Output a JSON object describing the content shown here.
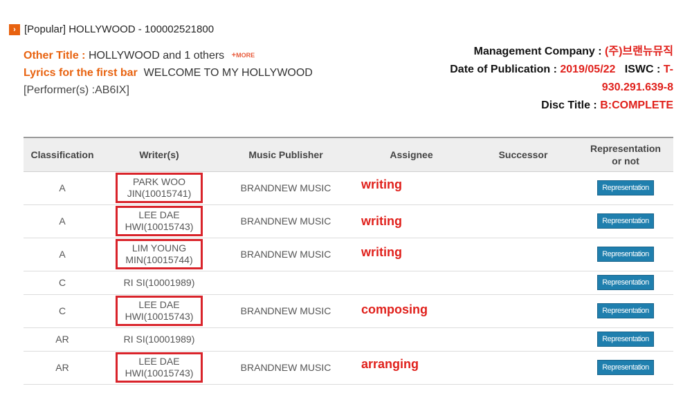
{
  "header": {
    "title": "[Popular] HOLLYWOOD - 100002521800",
    "icon": "chevron-right-icon"
  },
  "info_left": {
    "other_title_label": "Other Title :",
    "other_title_value": "HOLLYWOOD and 1 others",
    "more_label": "MORE",
    "lyrics_label": "Lyrics for the first bar",
    "lyrics_value": "WELCOME TO MY HOLLYWOOD",
    "performer": "[Performer(s) :AB6IX]"
  },
  "info_right": {
    "management_label": "Management Company :",
    "management_value": "(주)브랜뉴뮤직",
    "date_label": "Date of Publication :",
    "date_value": "2019/05/22",
    "iswc_label": "ISWC :",
    "iswc_value_part1": "T-",
    "iswc_value_part2": "930.291.639-8",
    "disc_label": "Disc Title :",
    "disc_value": "B:COMPLETE"
  },
  "table": {
    "headers": {
      "classification": "Classification",
      "writers": "Writer(s)",
      "publisher": "Music Publisher",
      "assignee": "Assignee",
      "successor": "Successor",
      "representation_1": "Representation",
      "representation_2": "or not"
    },
    "rows": [
      {
        "classification": "A",
        "writer_1": "PARK WOO",
        "writer_2": "JIN(10015741)",
        "publisher": "BRANDNEW MUSIC",
        "assignee": "writing",
        "successor": "",
        "button": "Representation"
      },
      {
        "classification": "A",
        "writer_1": "LEE DAE",
        "writer_2": "HWI(10015743)",
        "publisher": "BRANDNEW MUSIC",
        "assignee": "writing",
        "successor": "",
        "button": "Representation"
      },
      {
        "classification": "A",
        "writer_1": "LIM YOUNG",
        "writer_2": "MIN(10015744)",
        "publisher": "BRANDNEW MUSIC",
        "assignee": "writing",
        "successor": "",
        "button": "Representation"
      },
      {
        "classification": "C",
        "writer_1": "RI SI(10001989)",
        "writer_2": "",
        "publisher": "",
        "assignee": "",
        "successor": "",
        "button": "Representation"
      },
      {
        "classification": "C",
        "writer_1": "LEE DAE",
        "writer_2": "HWI(10015743)",
        "publisher": "BRANDNEW MUSIC",
        "assignee": "composing",
        "successor": "",
        "button": "Representation"
      },
      {
        "classification": "AR",
        "writer_1": "RI SI(10001989)",
        "writer_2": "",
        "publisher": "",
        "assignee": "",
        "successor": "",
        "button": "Representation"
      },
      {
        "classification": "AR",
        "writer_1": "LEE DAE",
        "writer_2": "HWI(10015743)",
        "publisher": "BRANDNEW MUSIC",
        "assignee": "arranging",
        "successor": "",
        "button": "Representation"
      }
    ]
  },
  "colors": {
    "accent_orange": "#e8620f",
    "highlight_red": "#e0201b",
    "button_blue": "#1f7fae",
    "annotation_box": "#d9232a"
  }
}
